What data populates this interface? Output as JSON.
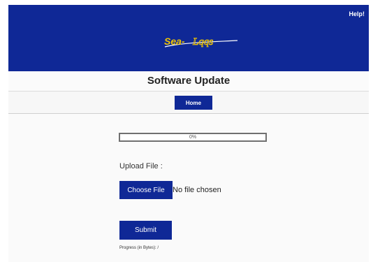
{
  "header": {
    "help_label": "Help!",
    "logo_text": "Sea-Lqqs",
    "background_color": "#0f2896",
    "logo_color": "#f2c600"
  },
  "page": {
    "title": "Software Update"
  },
  "nav": {
    "home_label": "Home"
  },
  "upload": {
    "progress_percent": 0,
    "progress_label": "0%",
    "upload_file_label": "Upload File :",
    "choose_file_label": "Choose File",
    "file_status": "No file chosen",
    "submit_label": "Submit",
    "progress_bytes_label": "Progress (in Bytes): /"
  },
  "icons": {
    "logo": "sea-lqqs-logo"
  },
  "colors": {
    "accent": "#0f2896"
  }
}
